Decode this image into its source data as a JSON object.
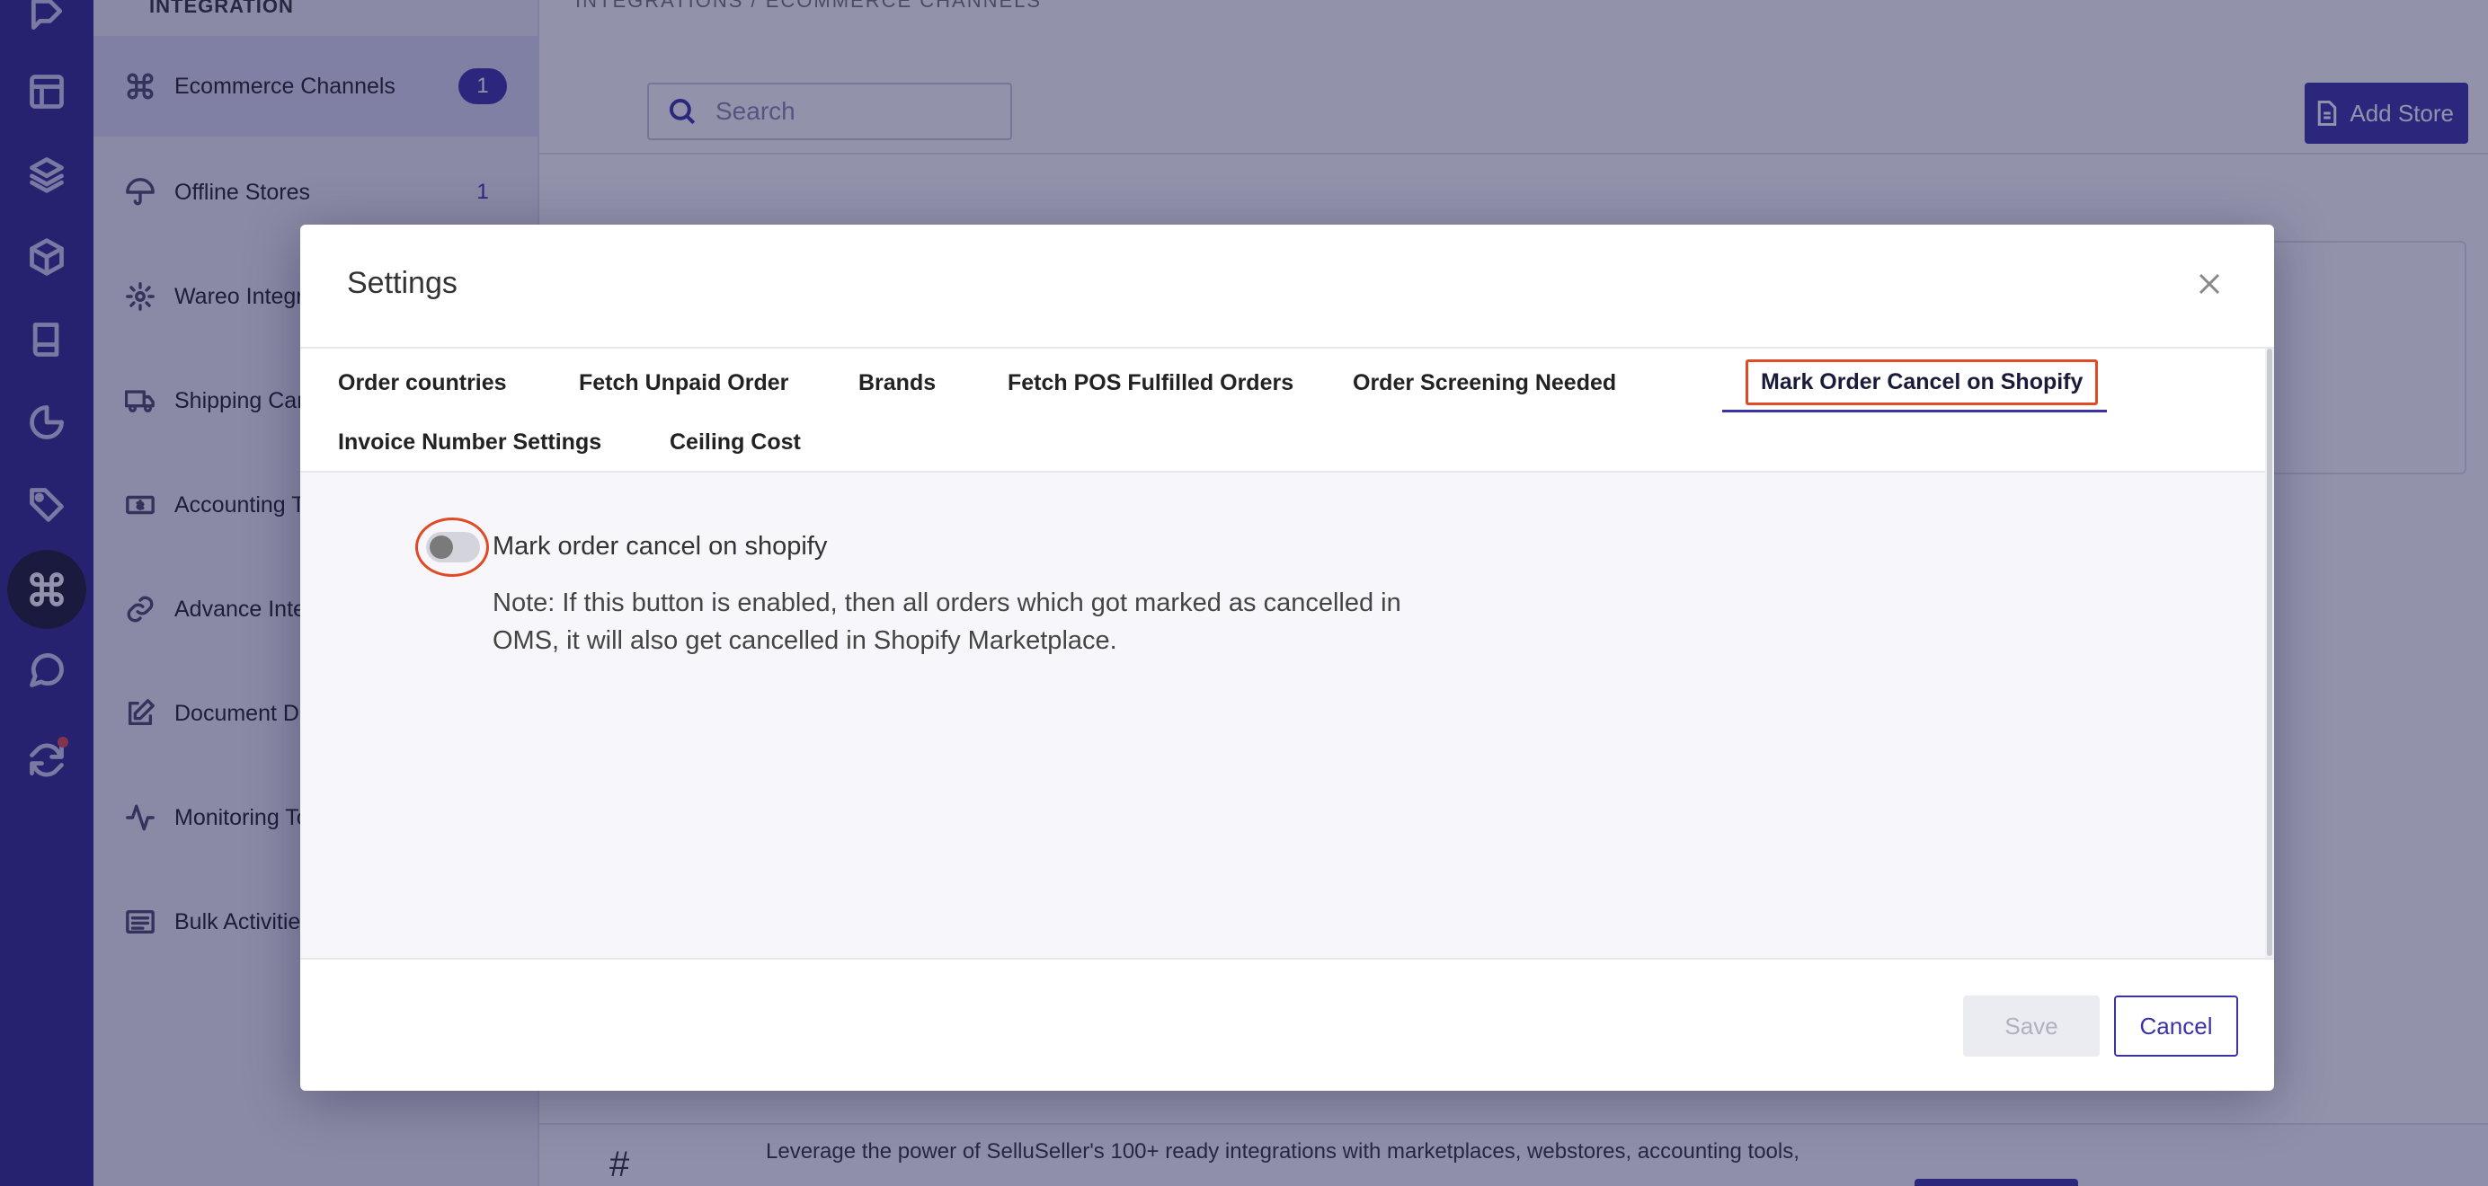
{
  "rail": {
    "icons": [
      "logo-icon",
      "layout-icon",
      "layers-icon",
      "box-icon",
      "book-icon",
      "pie-chart-icon",
      "tag-icon",
      "command-icon",
      "chat-icon",
      "refresh-icon"
    ],
    "active": "command-icon"
  },
  "sidebar": {
    "heading": "INTEGRATION",
    "items": [
      {
        "label": "Ecommerce Channels",
        "badge": "1",
        "icon": "command-icon",
        "active": true
      },
      {
        "label": "Offline Stores",
        "badge": "1",
        "icon": "umbrella-icon"
      },
      {
        "label": "Wareo Integration",
        "icon": "gear-icon"
      },
      {
        "label": "Shipping Carriers",
        "icon": "truck-icon"
      },
      {
        "label": "Accounting Tools",
        "icon": "money-icon"
      },
      {
        "label": "Advance Integrations",
        "icon": "link-icon"
      },
      {
        "label": "Document Designer",
        "icon": "edit-icon"
      },
      {
        "label": "Monitoring Tools",
        "icon": "activity-icon"
      },
      {
        "label": "Bulk Activities",
        "icon": "list-icon"
      }
    ]
  },
  "main": {
    "breadcrumb": "INTEGRATIONS   /   ECOMMERCE CHANNELS",
    "search": {
      "placeholder": "Search"
    },
    "add_store_label": "Add Store",
    "banner_text": "Leverage the power of SelluSeller's 100+ ready integrations with marketplaces, webstores, accounting tools,"
  },
  "modal": {
    "title": "Settings",
    "tabs": [
      "Order countries",
      "Fetch Unpaid Order",
      "Brands",
      "Fetch POS Fulfilled Orders",
      "Order Screening Needed",
      "Mark Order Cancel on Shopify",
      "Invoice Number Settings",
      "Ceiling Cost"
    ],
    "active_tab": "Mark Order Cancel on Shopify",
    "toggle_label": "Mark order cancel on shopify",
    "toggle_enabled": false,
    "note": "Note: If this button is enabled, then all orders which got marked as cancelled in OMS, it will also get cancelled in Shopify Marketplace.",
    "save_label": "Save",
    "cancel_label": "Cancel"
  },
  "colors": {
    "rail_bg": "#332a8e",
    "accent": "#3a33a8",
    "highlight": "#e04a24",
    "overlay": "rgba(28,28,80,0.48)"
  }
}
